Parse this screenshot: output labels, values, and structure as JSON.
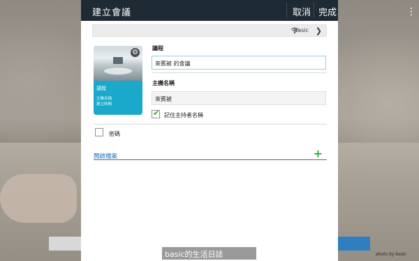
{
  "titlebar": {
    "title": "建立會議",
    "cancel_label": "取消",
    "done_label": "完成"
  },
  "server": {
    "name": "Basic",
    "icon": "wifi-icon",
    "chevron": "chevron-right-icon"
  },
  "thumbnail": {
    "topic": "議程",
    "line1": "主機名稱",
    "line2": "建立時間",
    "gear_icon": "gear-icon"
  },
  "form": {
    "topic_label": "議程",
    "topic_value": "來賓被 的會議",
    "host_label": "主機名稱",
    "host_value": "來賓被",
    "remember_label": "記住主持者名稱",
    "remember_checked": true,
    "password_label": "密碼",
    "password_checked": false,
    "open_file_label": "開啟檔案",
    "add_icon": "plus-icon"
  },
  "overlay": {
    "watermark": "basic的生活日誌",
    "signature": "photo by basic",
    "menu_icon": "more-vertical-icon"
  },
  "colors": {
    "titlebar": "#1e2b34",
    "accent_blue": "#1aa9cb",
    "link_blue": "#1e6fb8",
    "plus_green": "#2fae3a",
    "check_green": "#2f9e2f"
  }
}
